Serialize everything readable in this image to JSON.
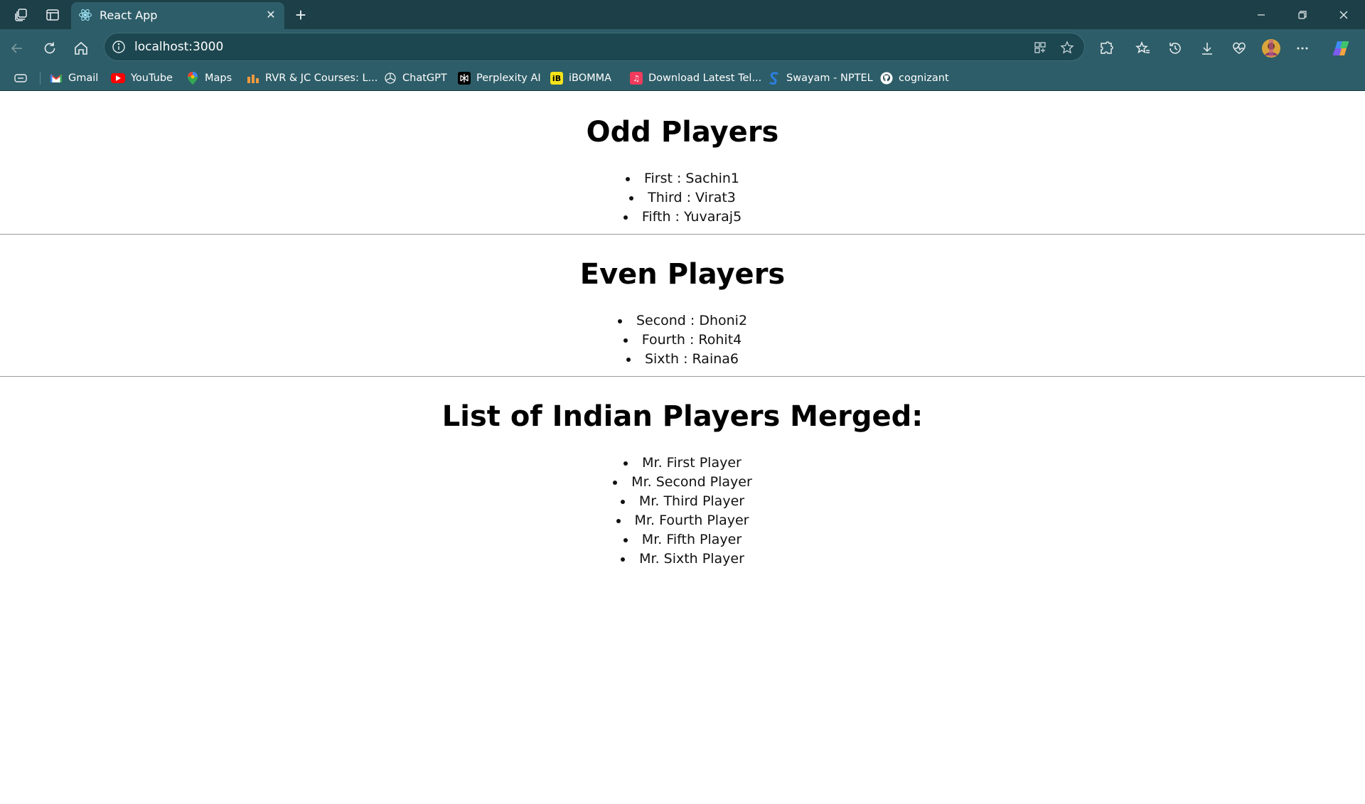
{
  "browser": {
    "tab": {
      "title": "React App"
    },
    "address_bar": {
      "url": "localhost:3000"
    },
    "bookmarks": [
      {
        "label": "Gmail",
        "icon": "gmail-icon"
      },
      {
        "label": "YouTube",
        "icon": "youtube-icon"
      },
      {
        "label": "Maps",
        "icon": "maps-icon"
      },
      {
        "label": "RVR & JC Courses: L...",
        "icon": "courses-icon"
      },
      {
        "label": "ChatGPT",
        "icon": "chatgpt-icon"
      },
      {
        "label": "Perplexity AI",
        "icon": "perplexity-icon"
      },
      {
        "label": "iBOMMA",
        "icon": "ibomma-icon"
      },
      {
        "label": "Download Latest Tel...",
        "icon": "music-icon"
      },
      {
        "label": "Swayam - NPTEL",
        "icon": "swayam-icon"
      },
      {
        "label": "cognizant",
        "icon": "github-icon"
      }
    ]
  },
  "odd": {
    "title": "Odd Players",
    "items": [
      "First : Sachin1",
      "Third : Virat3",
      "Fifth : Yuvaraj5"
    ]
  },
  "even": {
    "title": "Even Players",
    "items": [
      "Second : Dhoni2",
      "Fourth : Rohit4",
      "Sixth : Raina6"
    ]
  },
  "merged": {
    "title": "List of Indian Players Merged:",
    "items": [
      "Mr. First Player",
      "Mr. Second Player",
      "Mr. Third Player",
      "Mr. Fourth Player",
      "Mr. Fifth Player",
      "Mr. Sixth Player"
    ]
  }
}
